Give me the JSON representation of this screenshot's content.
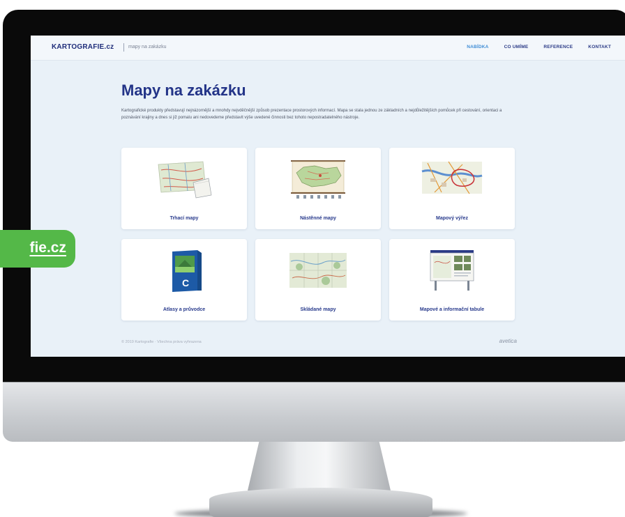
{
  "header": {
    "logo": "KARTOGRAFIE.cz",
    "tagline": "mapy na zakázku",
    "nav": [
      "NABÍDKA",
      "CO UMÍME",
      "REFERENCE",
      "KONTAKT"
    ]
  },
  "main": {
    "title": "Mapy na zakázku",
    "intro": "Kartografické produkty představují nejnázornější a mnohdy nejvděčnější způsob prezentace prostorových informací. Mapa se stala jednou ze základních a nejdůležitějších pomůcek při cestování, orientaci a poznávání krajiny a dnes si již pomalu ani nedovedeme představit výše uvedené činnosti bez tohoto nepostradatelného nástroje.",
    "cards": [
      {
        "label": "Trhací mapy",
        "icon": "tear-off-map-image"
      },
      {
        "label": "Nástěnné mapy",
        "icon": "wall-map-image"
      },
      {
        "label": "Mapový výřez",
        "icon": "map-cutout-image"
      },
      {
        "label": "Atlasy a průvodce",
        "icon": "atlas-book-image"
      },
      {
        "label": "Skládané mapy",
        "icon": "folded-map-image"
      },
      {
        "label": "Mapové a informační tabule",
        "icon": "info-board-image"
      }
    ]
  },
  "footer": {
    "copyright": "© 2019 Kartografie · Všechna práva vyhrazena",
    "credit": "avetica"
  },
  "badge": {
    "text": "fie.cz"
  },
  "colors": {
    "brand_navy": "#233488",
    "nav_active": "#3f8dd6",
    "badge_green": "#54b848",
    "screen_bg": "#e9f1f8"
  }
}
